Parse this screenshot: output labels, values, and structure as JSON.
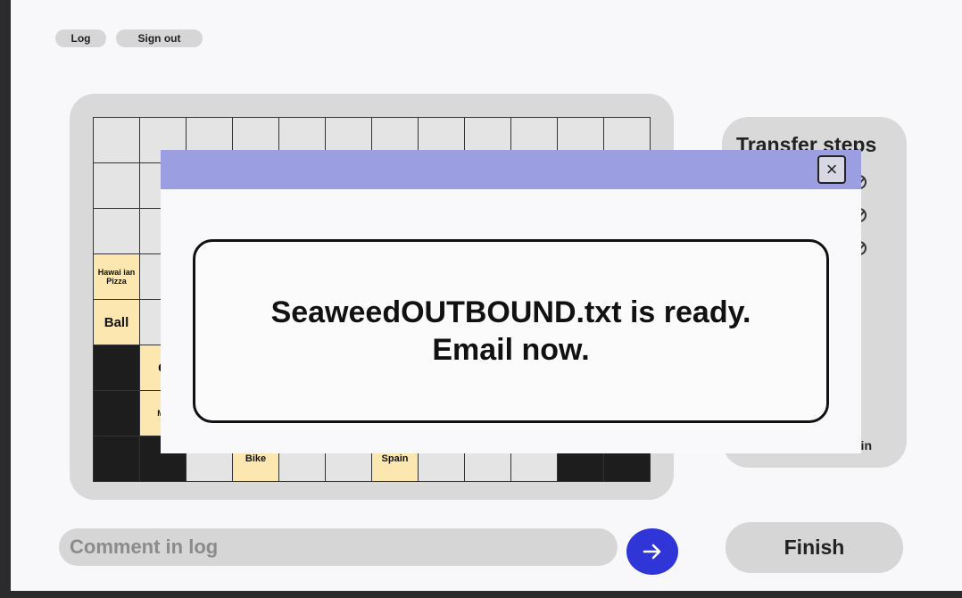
{
  "topbar": {
    "log_label": "Log",
    "signout_label": "Sign out"
  },
  "grid": {
    "rows": [
      [
        {
          "text": "",
          "type": "empty"
        },
        {
          "text": "",
          "type": "empty"
        },
        {
          "text": "",
          "type": "empty"
        },
        {
          "text": "",
          "type": "empty"
        },
        {
          "text": "",
          "type": "empty"
        },
        {
          "text": "",
          "type": "empty"
        },
        {
          "text": "",
          "type": "empty"
        },
        {
          "text": "",
          "type": "empty"
        },
        {
          "text": "",
          "type": "empty"
        },
        {
          "text": "",
          "type": "empty"
        },
        {
          "text": "",
          "type": "empty"
        },
        {
          "text": "",
          "type": "empty"
        }
      ],
      [
        {
          "text": "",
          "type": "empty"
        },
        {
          "text": "",
          "type": "empty"
        },
        {
          "text": "",
          "type": "empty"
        },
        {
          "text": "",
          "type": "empty"
        },
        {
          "text": "",
          "type": "empty"
        },
        {
          "text": "",
          "type": "empty"
        },
        {
          "text": "",
          "type": "empty"
        },
        {
          "text": "",
          "type": "empty"
        },
        {
          "text": "",
          "type": "empty"
        },
        {
          "text": "",
          "type": "empty"
        },
        {
          "text": "",
          "type": "empty"
        },
        {
          "text": "",
          "type": "empty"
        }
      ],
      [
        {
          "text": "",
          "type": "empty"
        },
        {
          "text": "",
          "type": "empty"
        },
        {
          "text": "",
          "type": "empty"
        },
        {
          "text": "",
          "type": "empty"
        },
        {
          "text": "",
          "type": "empty"
        },
        {
          "text": "",
          "type": "empty"
        },
        {
          "text": "",
          "type": "empty"
        },
        {
          "text": "",
          "type": "empty"
        },
        {
          "text": "",
          "type": "empty"
        },
        {
          "text": "",
          "type": "empty"
        },
        {
          "text": "",
          "type": "empty"
        },
        {
          "text": "",
          "type": "empty"
        }
      ],
      [
        {
          "text": "Hawai ian Pizza",
          "type": "word",
          "size": "tiny"
        },
        {
          "text": "",
          "type": "empty"
        },
        {
          "text": "",
          "type": "empty"
        },
        {
          "text": "",
          "type": "empty"
        },
        {
          "text": "",
          "type": "empty"
        },
        {
          "text": "",
          "type": "empty"
        },
        {
          "text": "",
          "type": "empty"
        },
        {
          "text": "",
          "type": "empty"
        },
        {
          "text": "",
          "type": "empty"
        },
        {
          "text": "",
          "type": "empty"
        },
        {
          "text": "",
          "type": "empty"
        },
        {
          "text": "",
          "type": "empty"
        }
      ],
      [
        {
          "text": "Ball",
          "type": "word",
          "size": "big"
        },
        {
          "text": "",
          "type": "empty"
        },
        {
          "text": "",
          "type": "empty"
        },
        {
          "text": "",
          "type": "empty"
        },
        {
          "text": "",
          "type": "empty"
        },
        {
          "text": "",
          "type": "empty"
        },
        {
          "text": "",
          "type": "empty"
        },
        {
          "text": "",
          "type": "empty"
        },
        {
          "text": "",
          "type": "empty"
        },
        {
          "text": "",
          "type": "empty"
        },
        {
          "text": "",
          "type": "empty"
        },
        {
          "text": "",
          "type": "empty"
        }
      ],
      [
        {
          "text": "",
          "type": "black"
        },
        {
          "text": "C",
          "type": "word",
          "size": "big"
        },
        {
          "text": "",
          "type": "empty"
        },
        {
          "text": "",
          "type": "empty"
        },
        {
          "text": "",
          "type": "empty"
        },
        {
          "text": "",
          "type": "empty"
        },
        {
          "text": "",
          "type": "empty"
        },
        {
          "text": "",
          "type": "empty"
        },
        {
          "text": "",
          "type": "empty"
        },
        {
          "text": "",
          "type": "empty"
        },
        {
          "text": "",
          "type": "empty"
        },
        {
          "text": "",
          "type": "empty"
        }
      ],
      [
        {
          "text": "",
          "type": "black"
        },
        {
          "text": "Me",
          "type": "word",
          "size": "tiny"
        },
        {
          "text": "",
          "type": "empty"
        },
        {
          "text": "",
          "type": "empty"
        },
        {
          "text": "",
          "type": "empty"
        },
        {
          "text": "",
          "type": "empty"
        },
        {
          "text": "",
          "type": "empty"
        },
        {
          "text": "",
          "type": "empty"
        },
        {
          "text": "",
          "type": "empty"
        },
        {
          "text": "",
          "type": "empty"
        },
        {
          "text": "",
          "type": "empty"
        },
        {
          "text": "",
          "type": "empty"
        }
      ],
      [
        {
          "text": "",
          "type": "black"
        },
        {
          "text": "",
          "type": "black"
        },
        {
          "text": "",
          "type": "empty"
        },
        {
          "text": "Bike",
          "type": "word",
          "size": "small"
        },
        {
          "text": "",
          "type": "empty"
        },
        {
          "text": "",
          "type": "empty"
        },
        {
          "text": "Spain",
          "type": "word",
          "size": "small"
        },
        {
          "text": "",
          "type": "empty"
        },
        {
          "text": "",
          "type": "empty"
        },
        {
          "text": "",
          "type": "empty"
        },
        {
          "text": "",
          "type": "black"
        },
        {
          "text": "",
          "type": "black"
        }
      ]
    ]
  },
  "steps": {
    "title": "Transfer steps",
    "time_fragment": "nin"
  },
  "comment": {
    "placeholder": "Comment in log"
  },
  "finish_label": "Finish",
  "modal": {
    "close_symbol": "×",
    "message_line1": "SeaweedOUTBOUND.txt is ready.",
    "message_line2": "Email now."
  },
  "colors": {
    "accent_blue": "#2f35d7",
    "modal_header": "#9b9ee1",
    "word_tile": "#fde7b0",
    "black_tile": "#1d1d1d",
    "panel_gray": "#d9d9d9"
  }
}
